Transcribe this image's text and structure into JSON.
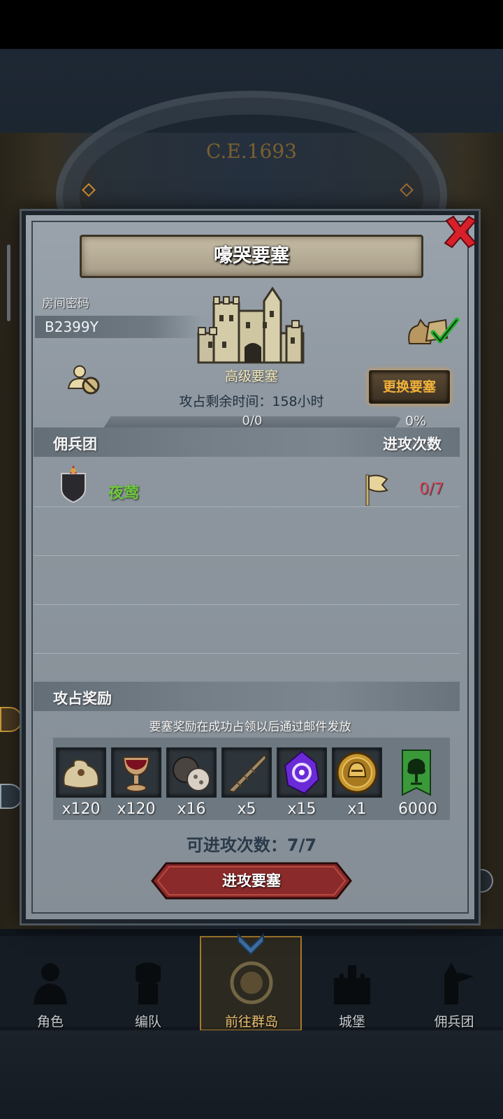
{
  "background": {
    "era_label": "C.E.1693"
  },
  "dialog": {
    "title": "嚎哭要塞",
    "room_label": "房间密码",
    "room_code": "B2399Y",
    "fortress_type": "高级要塞",
    "change_button": "更换要塞",
    "time_label": "攻占剩余时间：158小时",
    "progress": {
      "text": "0/0",
      "percent_text": "0%",
      "value": 0
    },
    "mercenary_header": "佣兵团",
    "attacks_header": "进攻次数",
    "mercenaries": [
      {
        "name": "夜莺",
        "attacks": "0/7"
      }
    ],
    "rewards_header": "攻占奖励",
    "rewards_note": "要塞奖励在成功占领以后通过邮件发放",
    "rewards": [
      {
        "icon": "sack-icon",
        "qty": "x120"
      },
      {
        "icon": "goblet-icon",
        "qty": "x120"
      },
      {
        "icon": "truffle-icon",
        "qty": "x16"
      },
      {
        "icon": "horn-icon",
        "qty": "x5"
      },
      {
        "icon": "crystal-icon",
        "qty": "x15"
      },
      {
        "icon": "helmet-coin-icon",
        "qty": "x1"
      },
      {
        "icon": "tree-banner-icon",
        "qty": "6000"
      }
    ],
    "attack_count_label": "可进攻次数：7/7",
    "attack_button": "进攻要塞"
  },
  "nav": {
    "items": [
      {
        "label": "角色",
        "icon": "character-icon"
      },
      {
        "label": "编队",
        "icon": "formation-icon"
      },
      {
        "label": "前往群岛",
        "icon": "islands-icon",
        "active": true
      },
      {
        "label": "城堡",
        "icon": "castle-icon"
      },
      {
        "label": "佣兵团",
        "icon": "mercenary-icon"
      }
    ]
  },
  "colors": {
    "accent_gold": "#f2b23a",
    "mercenary_green": "#6fc840",
    "count_red": "#d8445a"
  }
}
